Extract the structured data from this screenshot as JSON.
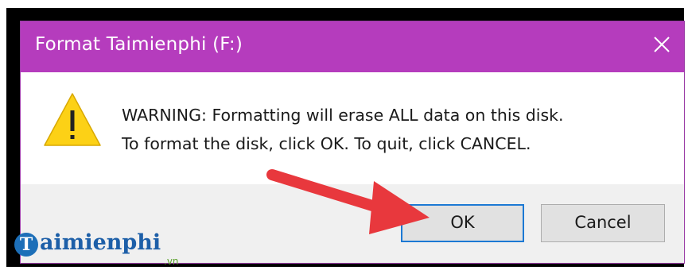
{
  "dialog": {
    "title": "Format Taimienphi (F:)",
    "close_icon": "close-icon",
    "warning_icon": "warning-triangle-icon",
    "message_line1": "WARNING: Formatting will erase ALL data on this disk.",
    "message_line2": "To format the disk, click OK. To quit, click CANCEL.",
    "ok_label": "OK",
    "cancel_label": "Cancel"
  },
  "annotation": {
    "arrow_icon": "red-arrow-icon",
    "arrow_color": "#e8383d"
  },
  "watermark": {
    "logo_letter": "T",
    "brand": "aimienphi",
    "suffix": ".vn"
  },
  "colors": {
    "titlebar": "#b53cbd",
    "ok_border": "#1c79d4",
    "warning_fill": "#fcd116"
  }
}
